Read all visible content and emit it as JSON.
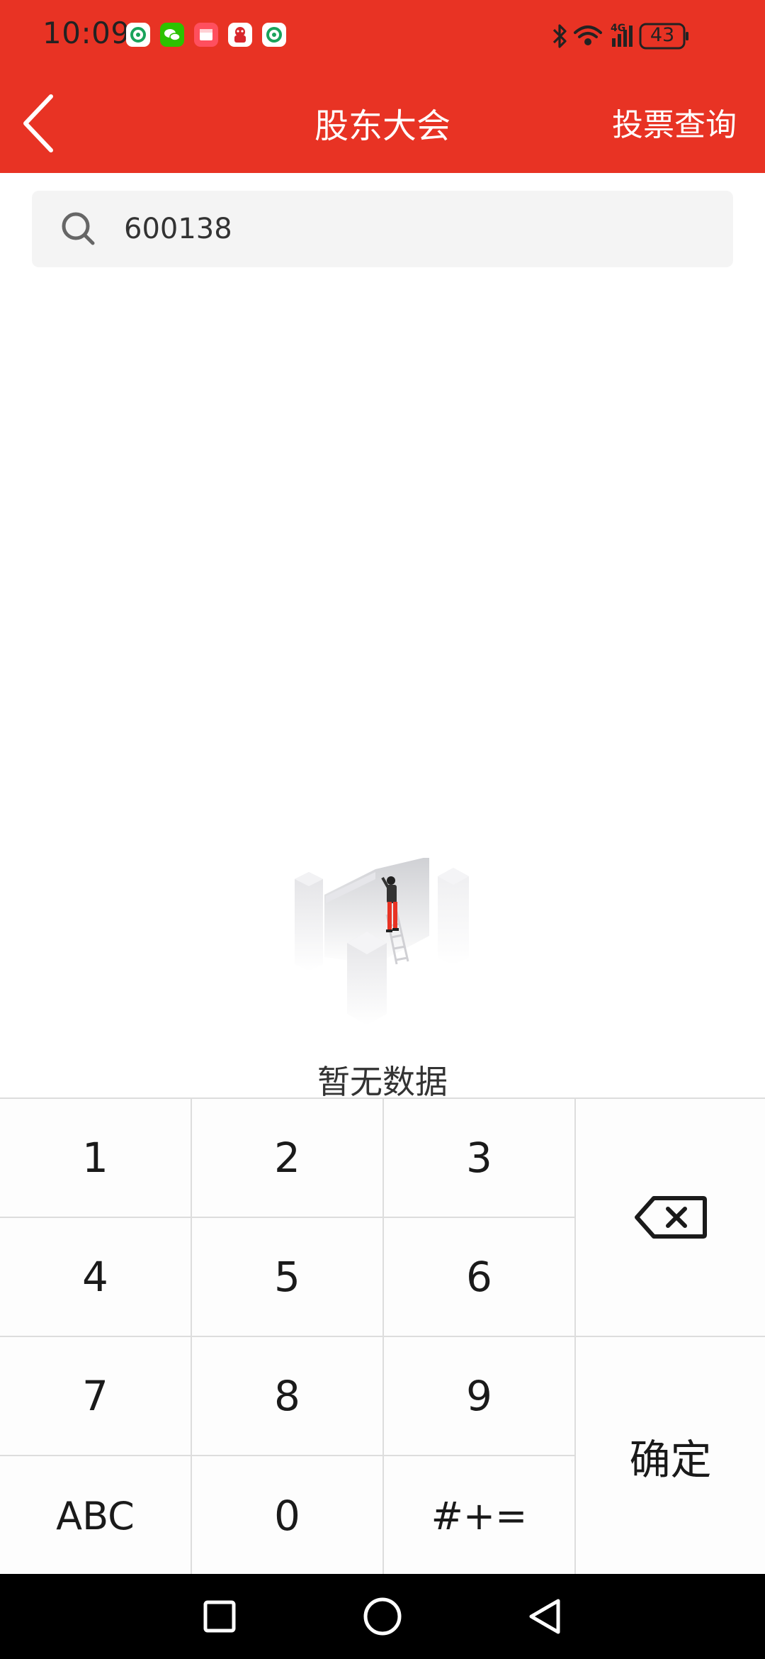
{
  "status_bar": {
    "time": "10:09",
    "network_label": "4G",
    "battery_level": "43",
    "notification_icons": [
      "china-mobile-icon",
      "wechat-icon",
      "calendar-icon",
      "shopping-icon",
      "china-mobile-icon"
    ]
  },
  "header": {
    "title": "股东大会",
    "right_action": "投票查询",
    "background_color": "#e83324"
  },
  "search": {
    "value": "600138"
  },
  "empty_state": {
    "message": "暂无数据"
  },
  "keypad": {
    "keys": [
      "1",
      "2",
      "3",
      "4",
      "5",
      "6",
      "7",
      "8",
      "9",
      "ABC",
      "0",
      "#+="
    ],
    "delete_icon": "backspace-icon",
    "confirm_label": "确定"
  },
  "nav_bar": {
    "buttons": [
      "recents-square-icon",
      "home-circle-icon",
      "back-triangle-icon"
    ]
  }
}
